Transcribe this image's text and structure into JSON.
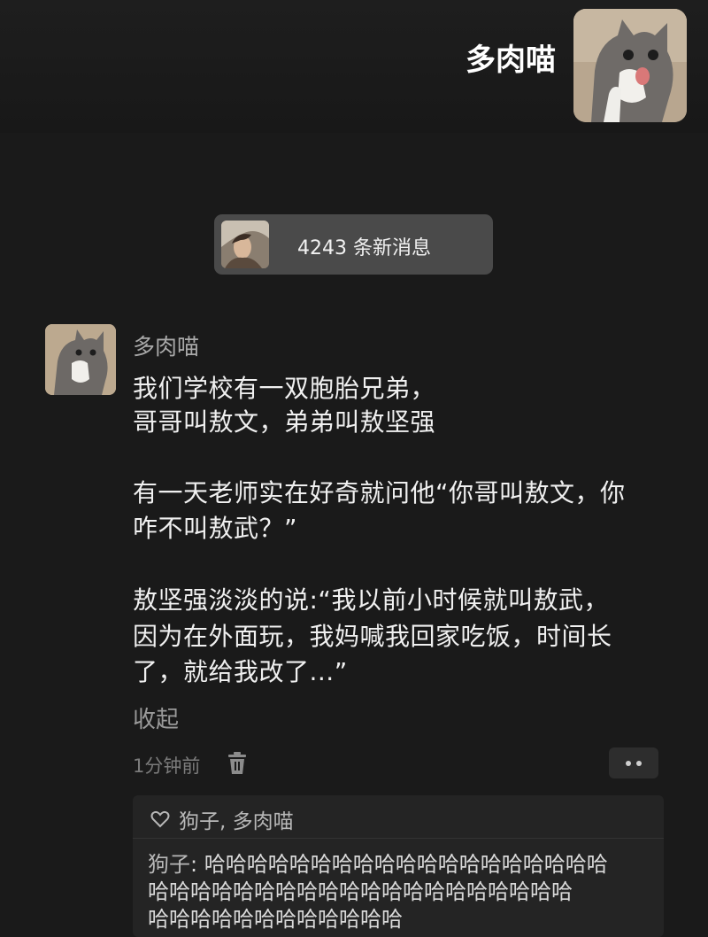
{
  "header": {
    "title": "多肉喵"
  },
  "new_messages": {
    "text": "4243 条新消息"
  },
  "comment": {
    "author": "多肉喵",
    "lines": [
      "我们学校有一双胞胎兄弟，",
      "哥哥叫敖文，弟弟叫敖坚强",
      "有一天老师实在好奇就问他“你哥叫敖文，你",
      "咋不叫敖武？”",
      "敖坚强淡淡的说:“我以前小时候就叫敖武，",
      "因为在外面玩，我妈喊我回家吃饭，时间长",
      "了，就给我改了...”"
    ],
    "collapse_label": "收起",
    "time": "1分钟前"
  },
  "reactions": {
    "likers": "狗子, 多肉喵"
  },
  "reply": {
    "author": "狗子",
    "separator": ": ",
    "lines": [
      "哈哈哈哈哈哈哈哈哈哈哈哈哈哈哈哈哈哈哈",
      "哈哈哈哈哈哈哈哈哈哈哈哈哈哈哈哈哈哈哈哈",
      "哈哈哈哈哈哈哈哈哈哈哈哈"
    ]
  },
  "icons": [
    "cat-avatar",
    "person-avatar",
    "trash-icon",
    "more-icon",
    "heart-outline-icon"
  ],
  "colors": {
    "background": "#1a1a1a",
    "pill": "#4a4a4a",
    "secondary_text": "#a9a9a9"
  }
}
